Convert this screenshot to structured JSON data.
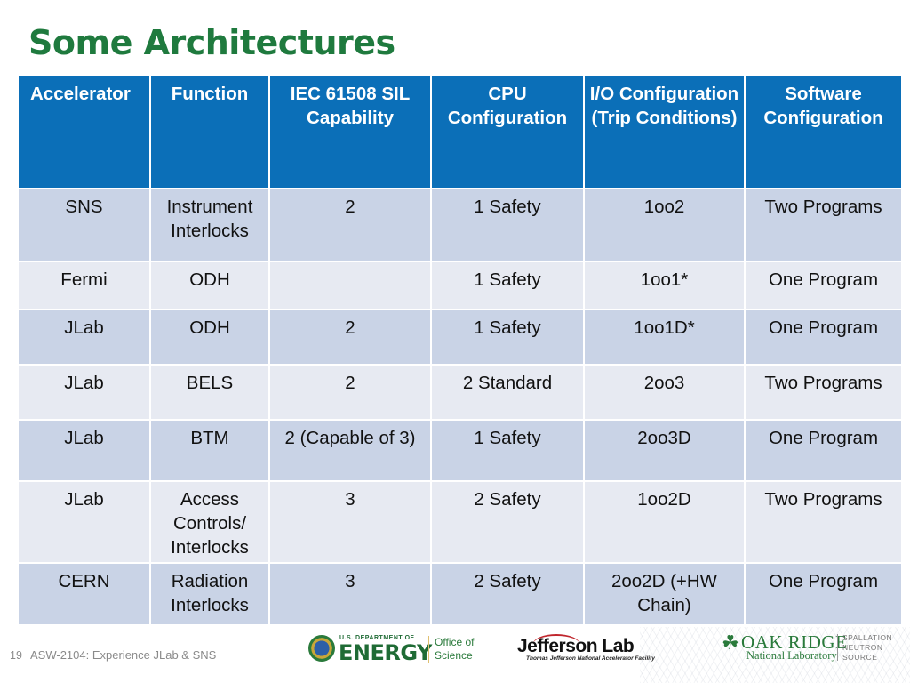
{
  "slide": {
    "title": "Some Architectures",
    "page_number": "19",
    "footer_text": "ASW-2104: Experience JLab & SNS"
  },
  "colors": {
    "title_green": "#1f7a3e",
    "header_blue": "#0b6fb8",
    "row_dark": "#c9d3e6",
    "row_light": "#e7eaf2"
  },
  "table": {
    "headers": [
      "Accelerator",
      "Function",
      "IEC 61508 SIL Capability",
      "CPU Configuration",
      "I/O Configuration (Trip Conditions)",
      "Software Configuration"
    ],
    "rows": [
      [
        "SNS",
        "Instrument Interlocks",
        "2",
        "1 Safety",
        "1oo2",
        "Two Programs"
      ],
      [
        "Fermi",
        "ODH",
        "",
        "1 Safety",
        "1oo1*",
        "One Program"
      ],
      [
        "JLab",
        "ODH",
        "2",
        "1 Safety",
        "1oo1D*",
        "One Program"
      ],
      [
        "JLab",
        "BELS",
        "2",
        "2 Standard",
        "2oo3",
        "Two Programs"
      ],
      [
        "JLab",
        "BTM",
        "2 (Capable of 3)",
        "1 Safety",
        "2oo3D",
        "One Program"
      ],
      [
        "JLab",
        "Access Controls/ Interlocks",
        "3",
        "2 Safety",
        "1oo2D",
        "Two Programs"
      ],
      [
        "CERN",
        "Radiation Interlocks",
        "3",
        "2 Safety",
        "2oo2D (+HW Chain)",
        "One Program"
      ]
    ]
  },
  "logos": {
    "doe": {
      "dept": "U.S. DEPARTMENT OF",
      "name": "ENERGY",
      "office_line1": "Office of",
      "office_line2": "Science"
    },
    "jlab": {
      "name": "Jefferson Lab",
      "subtitle": "Thomas Jefferson National Accelerator Facility"
    },
    "ornl": {
      "icon": "oak-leaf-icon",
      "name": "OAK RIDGE",
      "subtitle": "National Laboratory",
      "sns_line1": "SPALLATION",
      "sns_line2": "NEUTRON",
      "sns_line3": "SOURCE"
    }
  }
}
